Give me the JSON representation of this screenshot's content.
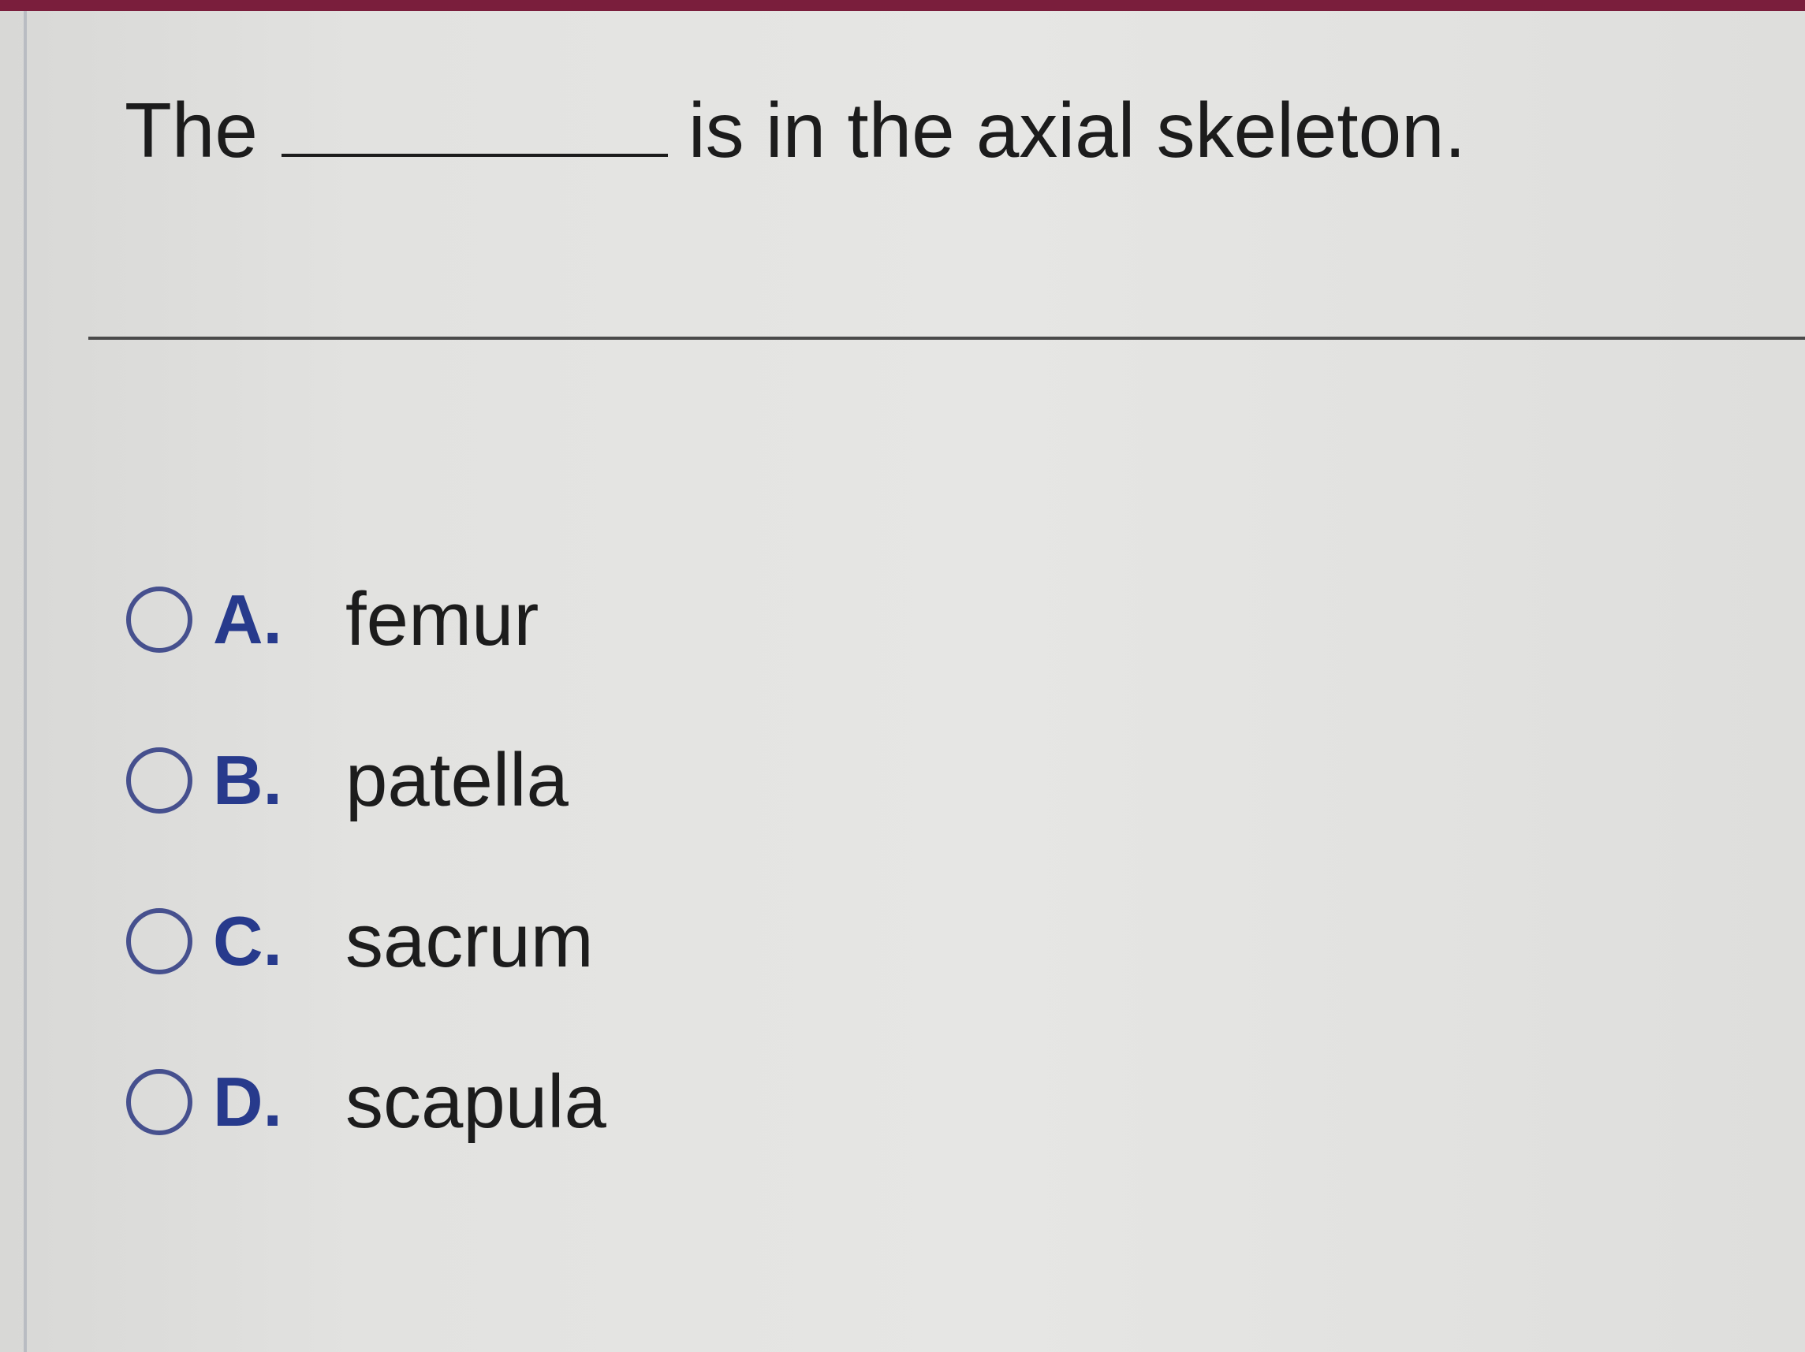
{
  "question": {
    "prefix": "The",
    "suffix": "is in the axial skeleton."
  },
  "options": [
    {
      "letter": "A.",
      "text": "femur"
    },
    {
      "letter": "B.",
      "text": "patella"
    },
    {
      "letter": "C.",
      "text": "sacrum"
    },
    {
      "letter": "D.",
      "text": "scapula"
    }
  ],
  "colors": {
    "top_bar": "#7a1e3c",
    "option_letter": "#273a8c",
    "radio_border": "#46508e",
    "text": "#1c1c1c"
  }
}
